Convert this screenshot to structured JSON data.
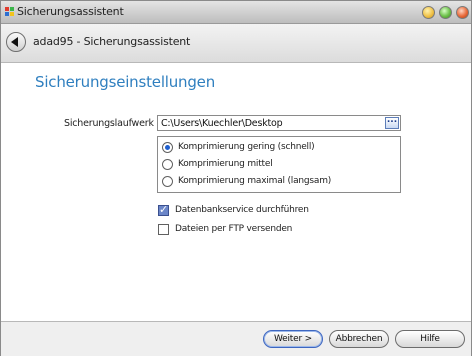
{
  "window": {
    "title": "Sicherungsassistent"
  },
  "nav": {
    "title": "adad95 - Sicherungsassistent"
  },
  "page": {
    "heading": "Sicherungseinstellungen"
  },
  "backup_drive": {
    "label": "Sicherungslaufwerk",
    "value": "C:\\Users\\Kuechler\\Desktop",
    "browse_label": "..."
  },
  "compression": {
    "options": [
      {
        "label": "Komprimierung gering (schnell)",
        "selected": true
      },
      {
        "label": "Komprimierung mittel",
        "selected": false
      },
      {
        "label": "Komprimierung maximal (langsam)",
        "selected": false
      }
    ]
  },
  "options": {
    "db_service": {
      "label": "Datenbankservice durchführen",
      "checked": true
    },
    "ftp": {
      "label": "Dateien per FTP versenden",
      "checked": false
    }
  },
  "footer": {
    "next": "Weiter >",
    "cancel": "Abbrechen",
    "help": "Hilfe"
  },
  "colors": {
    "heading": "#2f7fbf",
    "close": "#e86a3a",
    "minimize": "#f0c34a",
    "maximize": "#6cc04a"
  }
}
